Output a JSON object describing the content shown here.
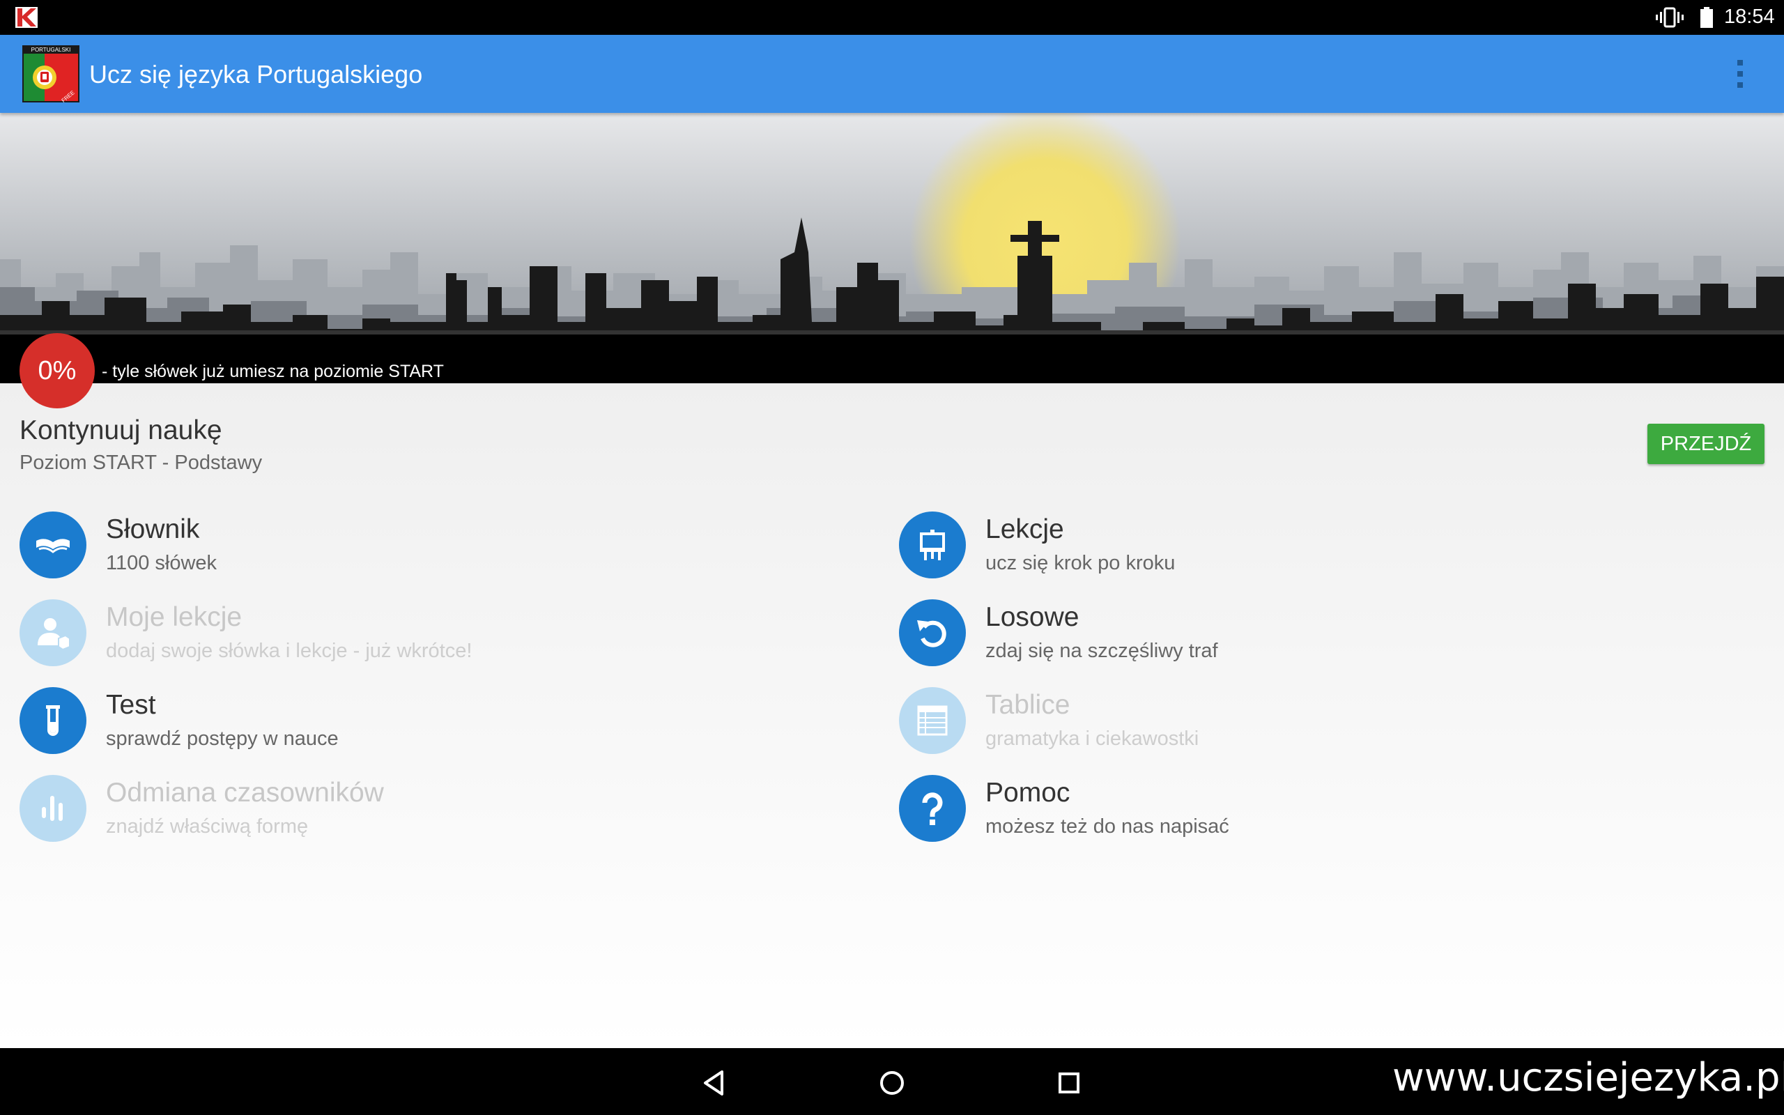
{
  "status_bar": {
    "time": "18:54",
    "icons": [
      "kaspersky-icon",
      "vibrate-icon",
      "battery-icon"
    ]
  },
  "app_bar": {
    "title": "Ucz się języka Portugalskiego",
    "logo_label": "PORTUGALSKI",
    "logo_badge": "FREE",
    "overflow_icon": "more-vert-icon"
  },
  "banner": {
    "progress_value": "0%",
    "progress_caption": "- tyle słówek już umiesz na poziomie START"
  },
  "continue": {
    "title": "Kontynuuj naukę",
    "subtitle": "Poziom START - Podstawy",
    "button_label": "PRZEJDŹ"
  },
  "menu": [
    {
      "title": "Słownik",
      "subtitle": "1100 słówek",
      "icon": "open-book-icon",
      "enabled": true
    },
    {
      "title": "Lekcje",
      "subtitle": "ucz się krok po kroku",
      "icon": "easel-icon",
      "enabled": true
    },
    {
      "title": "Moje lekcje",
      "subtitle": "dodaj swoje słówka i lekcje - już wkrótce!",
      "icon": "user-book-icon",
      "enabled": false
    },
    {
      "title": "Losowe",
      "subtitle": "zdaj się na szczęśliwy traf",
      "icon": "undo-arrow-icon",
      "enabled": true
    },
    {
      "title": "Test",
      "subtitle": "sprawdź postępy w nauce",
      "icon": "test-tube-icon",
      "enabled": true
    },
    {
      "title": "Tablice",
      "subtitle": "gramatyka i ciekawostki",
      "icon": "table-icon",
      "enabled": false
    },
    {
      "title": "Odmiana czasowników",
      "subtitle": "znajdź właściwą formę",
      "icon": "bars-icon",
      "enabled": false
    },
    {
      "title": "Pomoc",
      "subtitle": "możesz też do nas napisać",
      "icon": "question-icon",
      "enabled": true
    }
  ],
  "nav_bar": {
    "buttons": [
      "back-icon",
      "home-icon",
      "recents-icon"
    ],
    "watermark": "www.uczsiejezyka.pl"
  },
  "colors": {
    "app_bar": "#3b8fe8",
    "icon_blue": "#1b7ccf",
    "icon_disabled": "#b9dbf2",
    "progress_red": "#d62f2a",
    "button_green": "#3daa3f"
  }
}
